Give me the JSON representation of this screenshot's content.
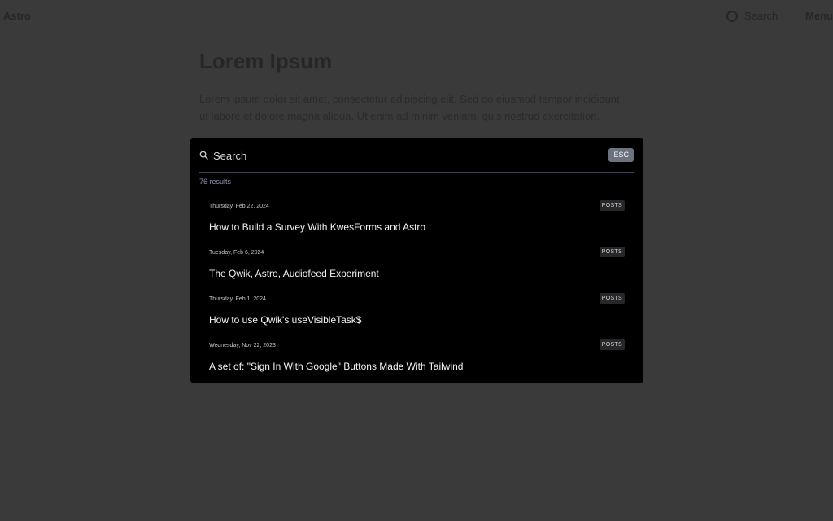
{
  "background": {
    "logo": "Astro",
    "search_label": "Search",
    "menu_label": "Menu",
    "page_title": "Lorem Ipsum",
    "page_intro": "Lorem ipsum dolor sit amet, consectetur adipiscing elit. Sed do eiusmod tempor incididunt ut labore et dolore magna aliqua. Ut enim ad minim veniam, quis nostrud exercitation."
  },
  "search": {
    "placeholder": "Search",
    "value": "",
    "esc_label": "ESC",
    "results_count": "76 results"
  },
  "results": [
    {
      "date": "Thursday, Feb 22, 2024",
      "badge": "POSTS",
      "title": "How to Build a Survey With KwesForms and Astro"
    },
    {
      "date": "Tuesday, Feb 6, 2024",
      "badge": "POSTS",
      "title": "The Qwik, Astro, Audiofeed Experiment"
    },
    {
      "date": "Thursday, Feb 1, 2024",
      "badge": "POSTS",
      "title": "How to use Qwik's useVisibleTask$"
    },
    {
      "date": "Wednesday, Nov 22, 2023",
      "badge": "POSTS",
      "title": "A set of: \"Sign In With Google\" Buttons Made With Tailwind"
    }
  ],
  "colors": {
    "overlay": "#3a3a3a",
    "modal_bg": "#000000",
    "divider": "#3b3f58",
    "esc_bg": "#6b7280",
    "count_text": "#8f95b8",
    "badge_bg": "#27272a"
  },
  "icons": {
    "search": "search-icon"
  }
}
